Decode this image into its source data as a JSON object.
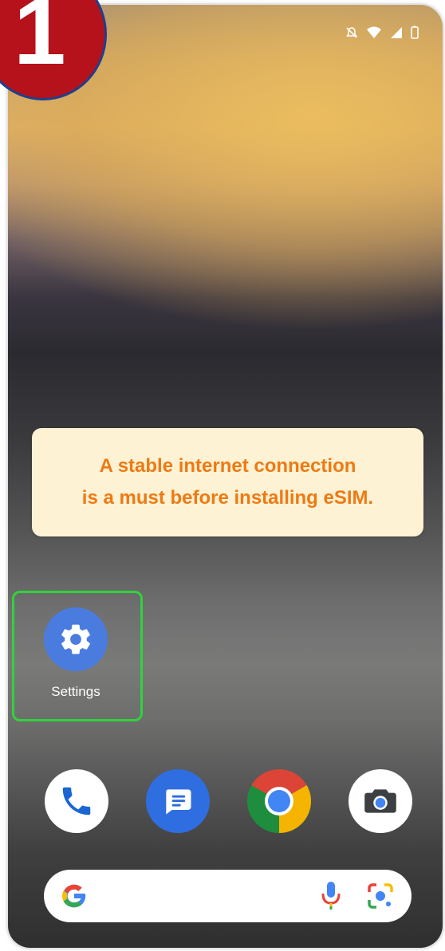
{
  "step_badge": {
    "number": "1"
  },
  "status_bar": {
    "icons": [
      "notifications-off-icon",
      "wifi-icon",
      "cell-signal-icon",
      "battery-icon"
    ]
  },
  "notice": {
    "line1": "A stable internet connection",
    "line2": "is a must before installing eSIM."
  },
  "home_apps": [
    {
      "label": "Settings",
      "icon": "settings-gear-icon",
      "highlighted": true
    }
  ],
  "dock": {
    "apps": [
      "phone-icon",
      "messages-icon",
      "chrome-icon",
      "camera-icon"
    ]
  },
  "search_bar": {
    "icons": [
      "google-g-icon",
      "microphone-icon",
      "google-lens-icon"
    ]
  },
  "colors": {
    "badge_red": "#b5121b",
    "notice_background": "#fdf2d3",
    "notice_text": "#ee7a14",
    "highlight_green": "#31d23c",
    "settings_blue": "#4a7ce0"
  }
}
